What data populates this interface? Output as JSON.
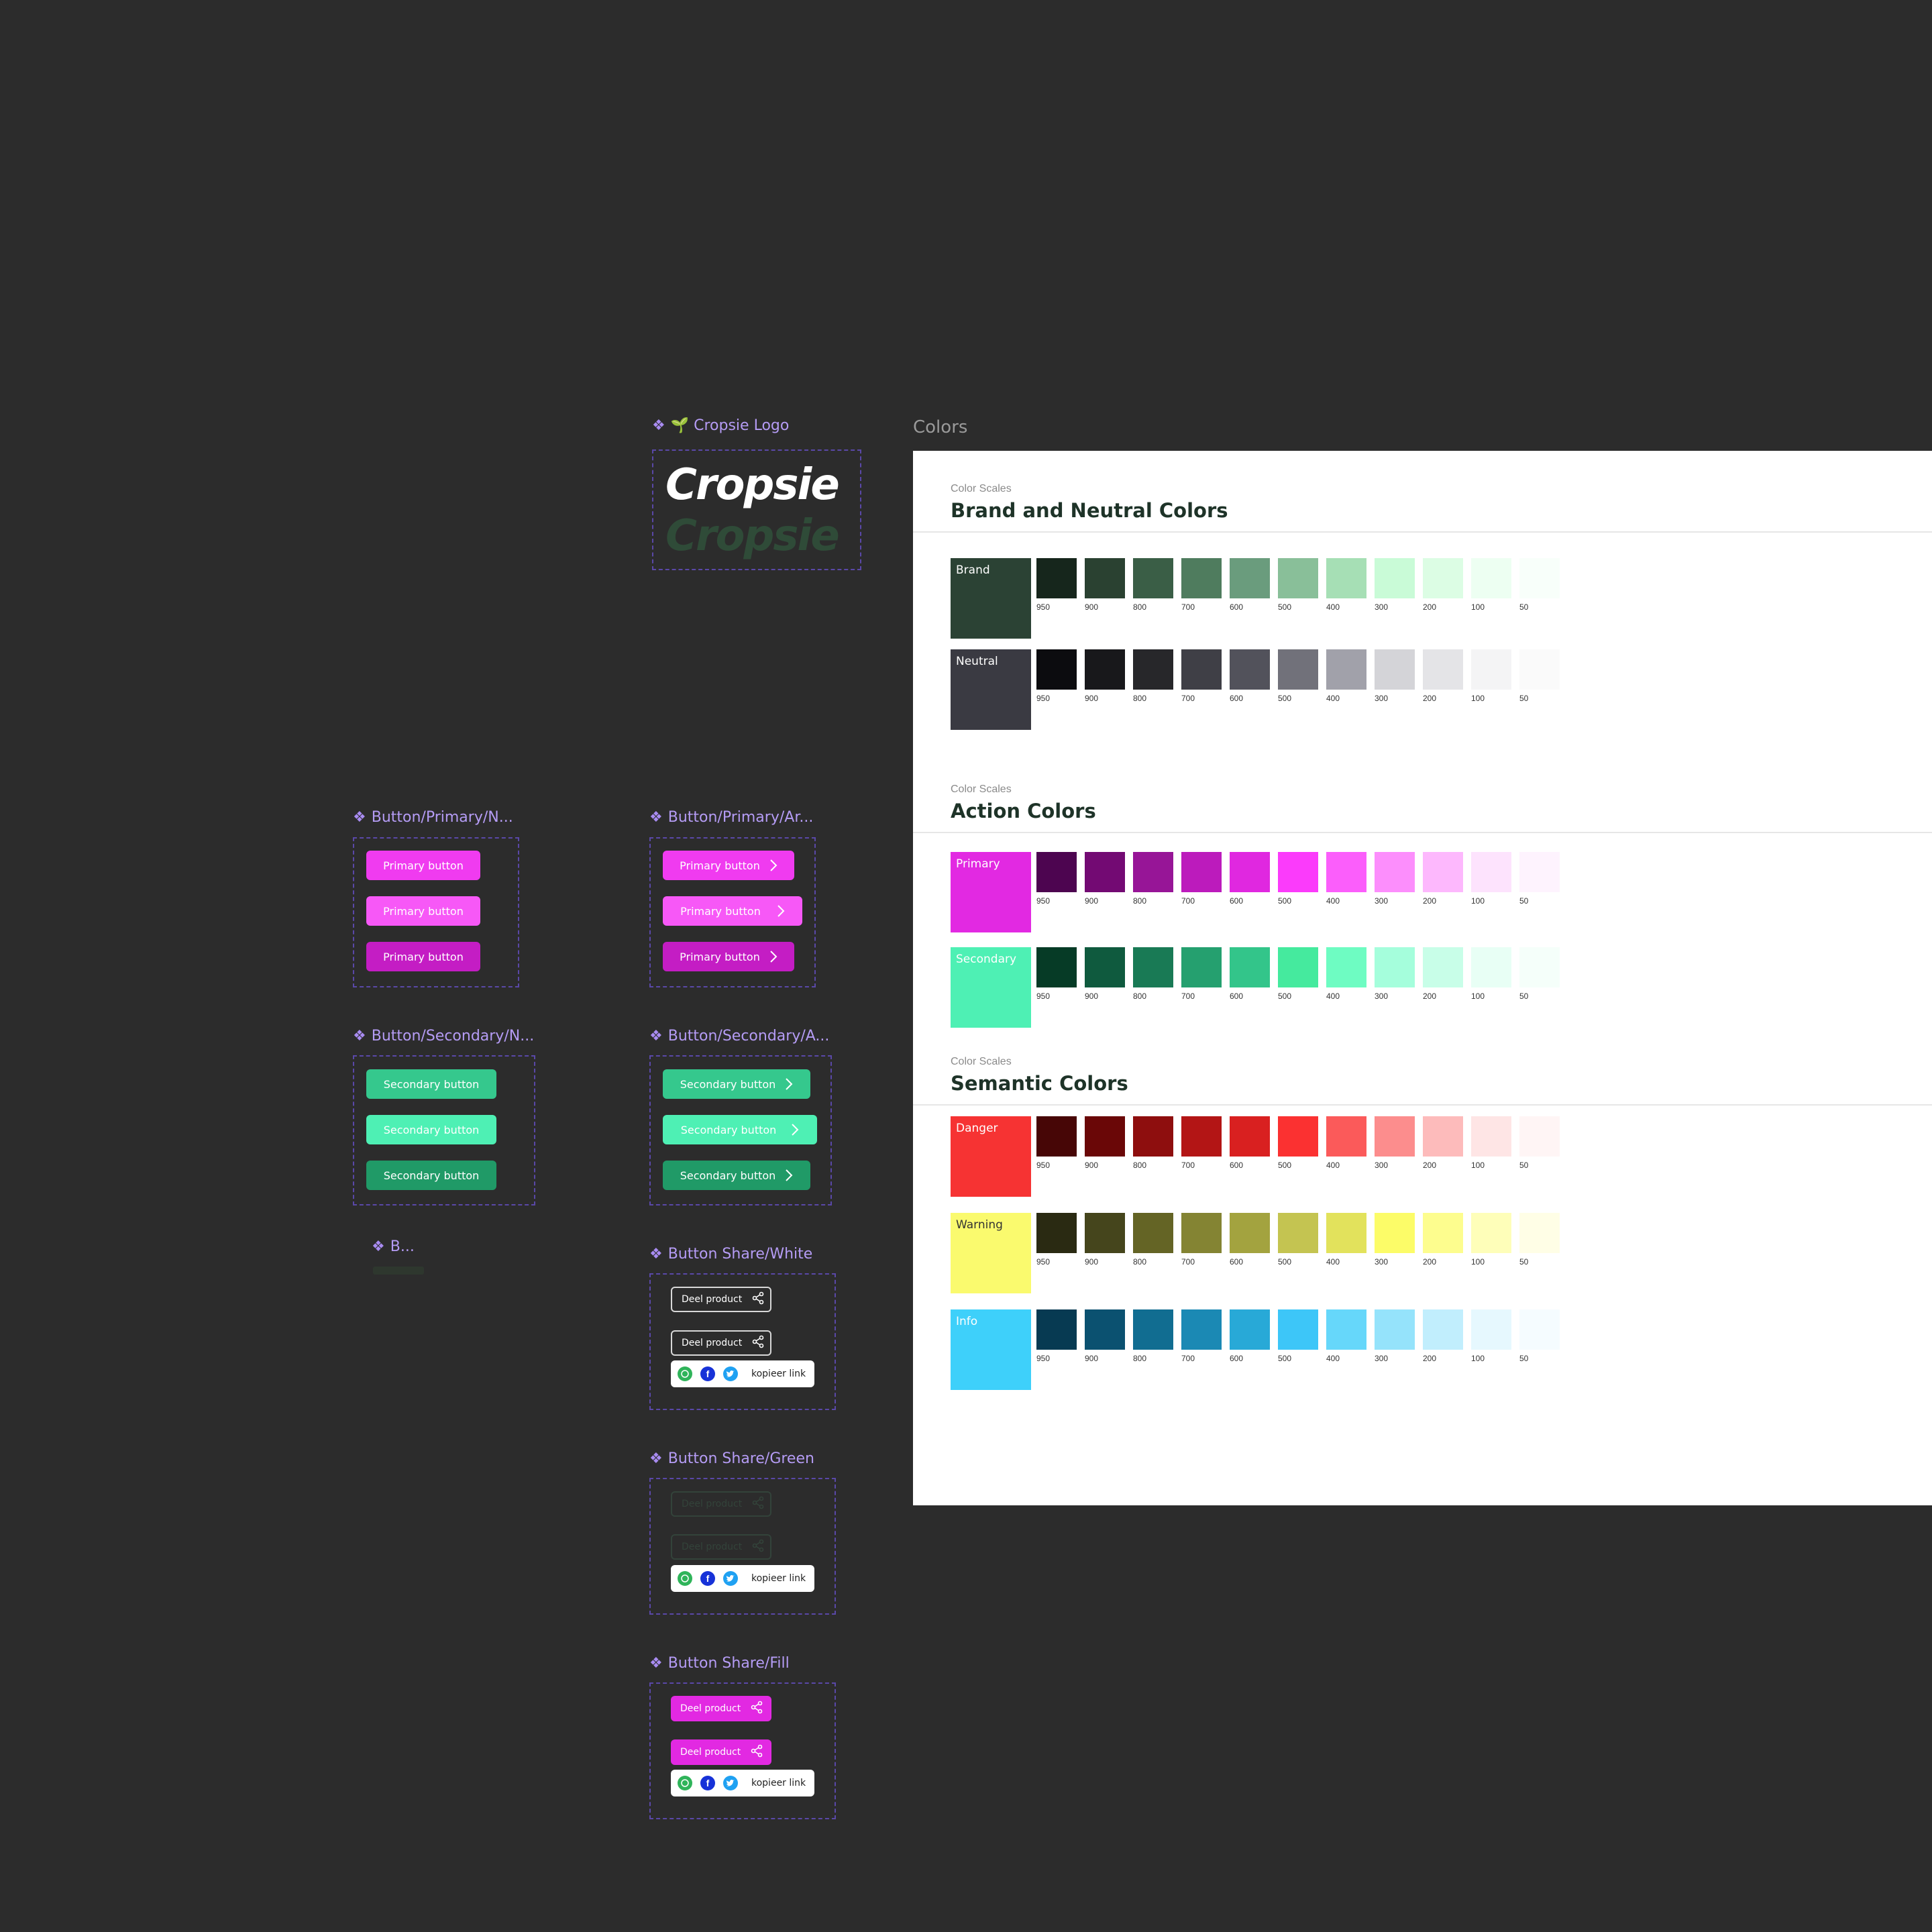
{
  "logo_component": {
    "title": "🌱 Cropsie Logo",
    "wordmark": "Cropsie",
    "wordmark_alt": "Cropsie"
  },
  "colors_label": "Colors",
  "component_titles": {
    "primary_normal": "Button/Primary/N...",
    "primary_arrow": "Button/Primary/Ar...",
    "secondary_normal": "Button/Secondary/N...",
    "secondary_arrow": "Button/Secondary/A...",
    "collapsed": "B...",
    "share_white": "Button Share/White",
    "share_green": "Button Share/Green",
    "share_fill": "Button Share/Fill"
  },
  "buttons": {
    "primary_label": "Primary button",
    "secondary_label": "Secondary button"
  },
  "share": {
    "label": "Deel product",
    "copy": "kopieer link"
  },
  "scale_labels": [
    "950",
    "900",
    "800",
    "700",
    "600",
    "500",
    "400",
    "300",
    "200",
    "100",
    "50"
  ],
  "sections": [
    {
      "overline": "Color Scales",
      "title": "Brand and Neutral Colors",
      "rows": [
        {
          "name": "Brand",
          "main": "#2b4234",
          "text": "#ffffff",
          "shades": [
            "#16261c",
            "#2a4131",
            "#3a5e46",
            "#4f7c5e",
            "#6a9c7d",
            "#89bf99",
            "#a6dfb5",
            "#c9fbd7",
            "#dcfde4",
            "#edfff2",
            "#f8fffa"
          ]
        },
        {
          "name": "Neutral",
          "main": "#3a3a42",
          "text": "#ffffff",
          "shades": [
            "#0c0c0f",
            "#18181b",
            "#27272a",
            "#3f3f46",
            "#52525b",
            "#71717a",
            "#a1a1aa",
            "#d4d4d8",
            "#e4e4e7",
            "#f4f4f5",
            "#fafafa"
          ]
        }
      ]
    },
    {
      "overline": "Color Scales",
      "title": "Action Colors",
      "rows": [
        {
          "name": "Primary",
          "main": "#e229e2",
          "text": "#ffffff",
          "shades": [
            "#4d0550",
            "#730a73",
            "#971597",
            "#bc1bbc",
            "#e028e0",
            "#fb3bfb",
            "#fb5efb",
            "#fc8efc",
            "#fdb8fd",
            "#fde3fd",
            "#fef3fe"
          ]
        },
        {
          "name": "Secondary",
          "main": "#4ef0b4",
          "text": "#ffffff",
          "shades": [
            "#063b26",
            "#0f5a3e",
            "#197a55",
            "#25a06f",
            "#33c58a",
            "#45ea9e",
            "#6efcc2",
            "#a5fedc",
            "#c8fee8",
            "#e8fff5",
            "#f5fffa"
          ]
        }
      ]
    },
    {
      "overline": "Color Scales",
      "title": "Semantic Colors",
      "rows": [
        {
          "name": "Danger",
          "main": "#f63333",
          "text": "#ffffff",
          "shades": [
            "#470606",
            "#6a0707",
            "#8e0e0e",
            "#b31515",
            "#d92020",
            "#fb3131",
            "#fb5a5a",
            "#fc8d8d",
            "#fdbbbb",
            "#fee5e5",
            "#fff5f5"
          ]
        },
        {
          "name": "Warning",
          "main": "#fafa6e",
          "text": "#333333",
          "shades": [
            "#2a2a12",
            "#45451c",
            "#646425",
            "#848433",
            "#a3a33f",
            "#c4c451",
            "#e2e25c",
            "#fcfc68",
            "#fdfd8e",
            "#fefeb9",
            "#fffee6"
          ]
        },
        {
          "name": "Info",
          "main": "#3ed0fa",
          "text": "#ffffff",
          "shades": [
            "#073a52",
            "#0b5170",
            "#116d91",
            "#1b89b4",
            "#28a9d7",
            "#3dc6f8",
            "#66d7fa",
            "#95e3fb",
            "#c1eefd",
            "#e6f8fe",
            "#f5fcff"
          ]
        }
      ]
    }
  ],
  "colors": {
    "primary": "#f03bf0",
    "primary_hover": "#f758f7",
    "primary_active": "#c41dc4",
    "secondary": "#35c88d",
    "secondary_hover": "#4ef0b4",
    "secondary_active": "#209a67",
    "frame_border": "#5a48a8",
    "title": "#b59cf5"
  }
}
